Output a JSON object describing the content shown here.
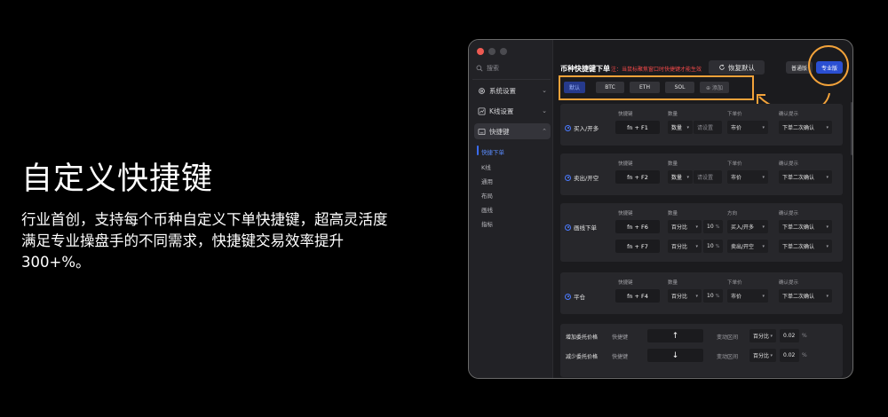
{
  "hero": {
    "title": "自定义快捷键",
    "desc_line1": "行业首创，支持每个币种自定义下单快捷键，超高灵活度",
    "desc_line2": "满足专业操盘手的不同需求，快捷键交易效率提升",
    "desc_line3": "300+%。"
  },
  "sidebar": {
    "search_placeholder": "搜索",
    "items": [
      {
        "label": "系统设置",
        "icon": "gear-icon"
      },
      {
        "label": "K线设置",
        "icon": "chart-icon"
      },
      {
        "label": "快捷键",
        "icon": "keyboard-icon"
      }
    ],
    "subitems": [
      "快捷下单",
      "K线",
      "通用",
      "布局",
      "画线",
      "指标"
    ]
  },
  "header": {
    "title": "币种快捷键下单",
    "note": "注：当鼠标聚焦窗口时快捷键才能生效",
    "restore": "恢复默认",
    "normal": "普通版",
    "pro": "专业版"
  },
  "tabs": [
    "默认",
    "BTC",
    "ETH",
    "SOL",
    "⊕ 添加"
  ],
  "cols": {
    "key": "快捷键",
    "qty": "数量",
    "price": "下单价",
    "confirm": "确认提示",
    "direction": "方向"
  },
  "buy": {
    "label": "买入/开多",
    "key": "fn + F1",
    "qty_sel": "数量",
    "qty_ph": "请设置",
    "price": "市价",
    "confirm": "下单二次确认"
  },
  "sell": {
    "label": "卖出/开空",
    "key": "fn + F2",
    "qty_sel": "数量",
    "qty_ph": "请设置",
    "price": "市价",
    "confirm": "下单二次确认"
  },
  "line": {
    "label": "画线下单",
    "rows": [
      {
        "key": "fn + F6",
        "qty_sel": "百分比",
        "qty_val": "10",
        "unit": "%",
        "dir": "买入/开多",
        "confirm": "下单二次确认"
      },
      {
        "key": "fn + F7",
        "qty_sel": "百分比",
        "qty_val": "10",
        "unit": "%",
        "dir": "卖出/开空",
        "confirm": "下单二次确认"
      }
    ]
  },
  "close": {
    "label": "平仓",
    "key": "fn + F4",
    "qty_sel": "百分比",
    "qty_val": "10",
    "unit": "%",
    "price": "市价",
    "confirm": "下单二次确认"
  },
  "price_adj": {
    "rows": [
      {
        "label": "增加委托价格",
        "key_label": "快捷键",
        "arrow": "↑",
        "range_label": "变动区间",
        "sel": "百分比",
        "val": "0.02",
        "unit": "%"
      },
      {
        "label": "减少委托价格",
        "key_label": "快捷键",
        "arrow": "↓",
        "range_label": "变动区间",
        "sel": "百分比",
        "val": "0.02",
        "unit": "%"
      }
    ]
  },
  "colors": {
    "accent": "#2a4fd2",
    "highlight": "#f2a23a",
    "warning": "#f04848"
  }
}
